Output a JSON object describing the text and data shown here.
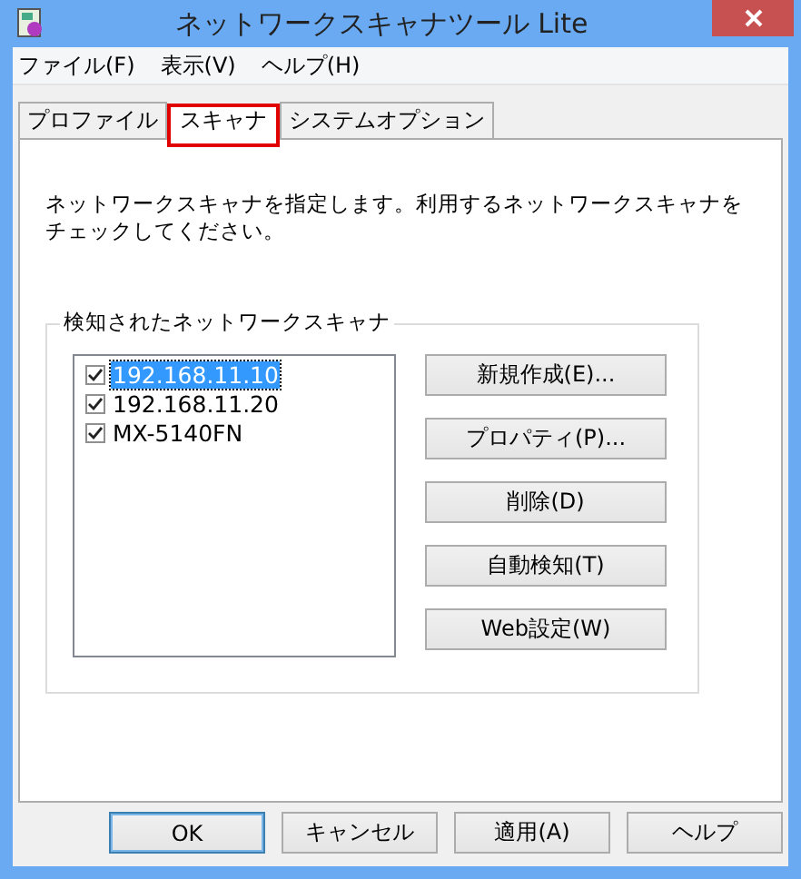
{
  "window": {
    "title": "ネットワークスキャナツール Lite"
  },
  "menu": [
    "ファイル(F)",
    "表示(V)",
    "ヘルプ(H)"
  ],
  "tabs": [
    {
      "label": "プロファイル",
      "selected": false
    },
    {
      "label": "スキャナ",
      "selected": true
    },
    {
      "label": "システムオプション",
      "selected": false
    }
  ],
  "description": "ネットワークスキャナを指定します。利用するネットワークスキャナをチェックしてください。",
  "group": {
    "title": "検知されたネットワークスキャナ",
    "scanners": [
      {
        "name": "192.168.11.10",
        "checked": true,
        "selected": true
      },
      {
        "name": "192.168.11.20",
        "checked": true,
        "selected": false
      },
      {
        "name": "MX-5140FN",
        "checked": true,
        "selected": false
      }
    ],
    "buttons": [
      "新規作成(E)...",
      "プロパティ(P)...",
      "削除(D)",
      "自動検知(T)",
      "Web設定(W)"
    ]
  },
  "footer_buttons": [
    {
      "label": "OK",
      "default": true
    },
    {
      "label": "キャンセル",
      "default": false
    },
    {
      "label": "適用(A)",
      "default": false
    },
    {
      "label": "ヘルプ",
      "default": false
    }
  ]
}
